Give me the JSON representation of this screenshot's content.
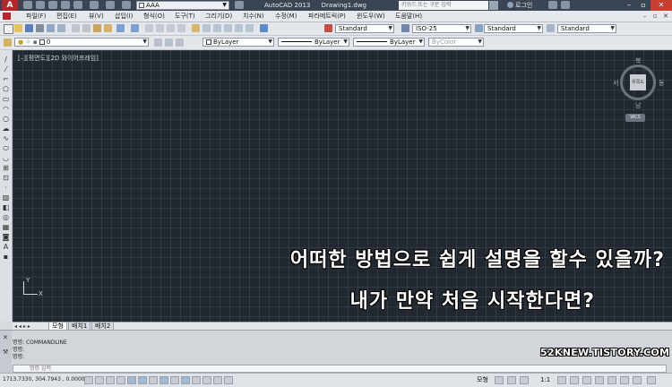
{
  "titlebar": {
    "logo": "A",
    "workspace": "AAA",
    "app_title": "AutoCAD 2013",
    "doc_title": "Drawing1.dwg",
    "search_placeholder": "키워드 또는 구문 입력",
    "login_label": "로그인",
    "controls": [
      "–",
      "▫",
      "✕"
    ]
  },
  "menu": {
    "items": [
      "파일(F)",
      "편집(E)",
      "뷰(V)",
      "삽입(I)",
      "형식(O)",
      "도구(T)",
      "그리기(D)",
      "치수(N)",
      "수정(M)",
      "파라메트릭(P)",
      "윈도우(W)",
      "도움말(H)"
    ],
    "ctrl_min": "–",
    "ctrl_restore": "▫",
    "ctrl_close": "✕"
  },
  "styles_toolbar": {
    "text_style": "Standard",
    "dim_style": "ISO-25",
    "table_style": "Standard",
    "mleader_style": "Standard"
  },
  "properties_toolbar": {
    "layer": "0",
    "color": "ByLayer",
    "linetype": "ByLayer",
    "lineweight": "ByLayer",
    "plotstyle": "ByColor"
  },
  "viewport": {
    "label": "[–][평면도][2D 와이어프레임]",
    "viewcube": {
      "north": "북",
      "south": "남",
      "west": "서",
      "east": "동",
      "face": "위쪽도"
    },
    "wcs": "WCS",
    "ucs_x": "X",
    "ucs_y": "Y"
  },
  "overlay": {
    "line1": "어떠한 방법으로 쉽게 설명을 할수 있을까?",
    "line2": "내가 만약 처음 시작한다면?"
  },
  "layout_tabs": {
    "nav": "◂ ◂ ▸ ▸",
    "tabs": [
      "모형",
      "배치1",
      "배치2"
    ]
  },
  "command": {
    "history": [
      "명령: COMMANDLINE",
      "명령:",
      "명령:"
    ],
    "placeholder": "명령 입력"
  },
  "watermark": "52KNEW.TISTORY.COM",
  "statusbar": {
    "coords": "1713.7330, 304.7943 , 0.0000",
    "model": "모형",
    "scale": "1:1"
  },
  "colors": {
    "canvas": "#212830",
    "titlebar": "#3b4452",
    "logo": "#b3262b"
  }
}
